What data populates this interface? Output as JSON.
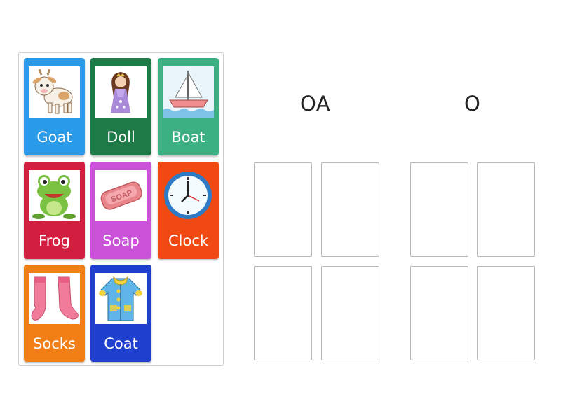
{
  "headings": [
    "OA",
    "O"
  ],
  "cards": [
    {
      "label": "Goat",
      "color": "#2a9be8",
      "icon": "goat-icon"
    },
    {
      "label": "Doll",
      "color": "#1e7b47",
      "icon": "doll-icon"
    },
    {
      "label": "Boat",
      "color": "#3db083",
      "icon": "boat-icon"
    },
    {
      "label": "Frog",
      "color": "#d21f3f",
      "icon": "frog-icon"
    },
    {
      "label": "Soap",
      "color": "#c952d9",
      "icon": "soap-icon"
    },
    {
      "label": "Clock",
      "color": "#f04a12",
      "icon": "clock-icon"
    },
    {
      "label": "Socks",
      "color": "#f27f16",
      "icon": "socks-icon"
    },
    {
      "label": "Coat",
      "color": "#1f3fcf",
      "icon": "coat-icon"
    }
  ]
}
